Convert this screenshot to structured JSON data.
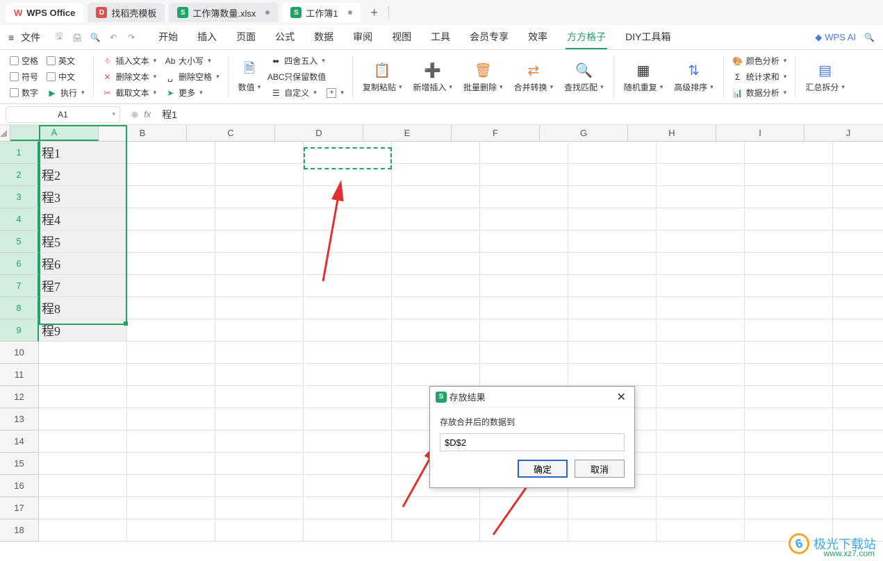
{
  "app": {
    "name": "WPS Office"
  },
  "tabs": [
    {
      "icon": "D",
      "label": "找稻壳模板"
    },
    {
      "icon": "S",
      "label": "工作簿数量.xlsx"
    },
    {
      "icon": "S",
      "label": "工作簿1"
    }
  ],
  "menu": {
    "file": "文件",
    "items": [
      "开始",
      "插入",
      "页面",
      "公式",
      "数据",
      "审阅",
      "视图",
      "工具",
      "会员专享",
      "效率",
      "方方格子",
      "DIY工具箱"
    ],
    "active_index": 10,
    "ai": "WPS AI"
  },
  "ribbon": {
    "g1": {
      "a": "空格",
      "b": "符号",
      "c": "数字",
      "d": "英文",
      "e": "中文",
      "f": "执行"
    },
    "g2": {
      "a": "插入文本",
      "b": "删除文本",
      "c": "截取文本"
    },
    "g3": {
      "a": "大小写",
      "b": "删除空格",
      "c": "更多"
    },
    "g4": {
      "a": "数值",
      "b": "四舍五入",
      "c": "只保留数值",
      "d": "自定义"
    },
    "g5": {
      "a": "复制粘贴",
      "b": "新增插入",
      "c": "批量删除",
      "d": "合并转换",
      "e": "查找匹配"
    },
    "g6": {
      "a": "随机重复",
      "b": "高级排序"
    },
    "g7": {
      "a": "颜色分析",
      "b": "统计求和",
      "c": "数据分析"
    },
    "g8": {
      "a": "汇总拆分"
    }
  },
  "formula_bar": {
    "name_box": "A1",
    "fx": "fx",
    "content": "程1"
  },
  "columns": [
    "A",
    "B",
    "C",
    "D",
    "E",
    "F",
    "G",
    "H",
    "I",
    "J"
  ],
  "row_count": 18,
  "data_cells": [
    "程1",
    "程2",
    "程3",
    "程4",
    "程5",
    "程6",
    "程7",
    "程8",
    "程9"
  ],
  "dialog": {
    "title": "存放结果",
    "label": "存放合并后的数据到",
    "input_value": "$D$2",
    "ok": "确定",
    "cancel": "取消"
  },
  "watermark": {
    "text": "极光下载站",
    "url": "www.xz7.com"
  }
}
